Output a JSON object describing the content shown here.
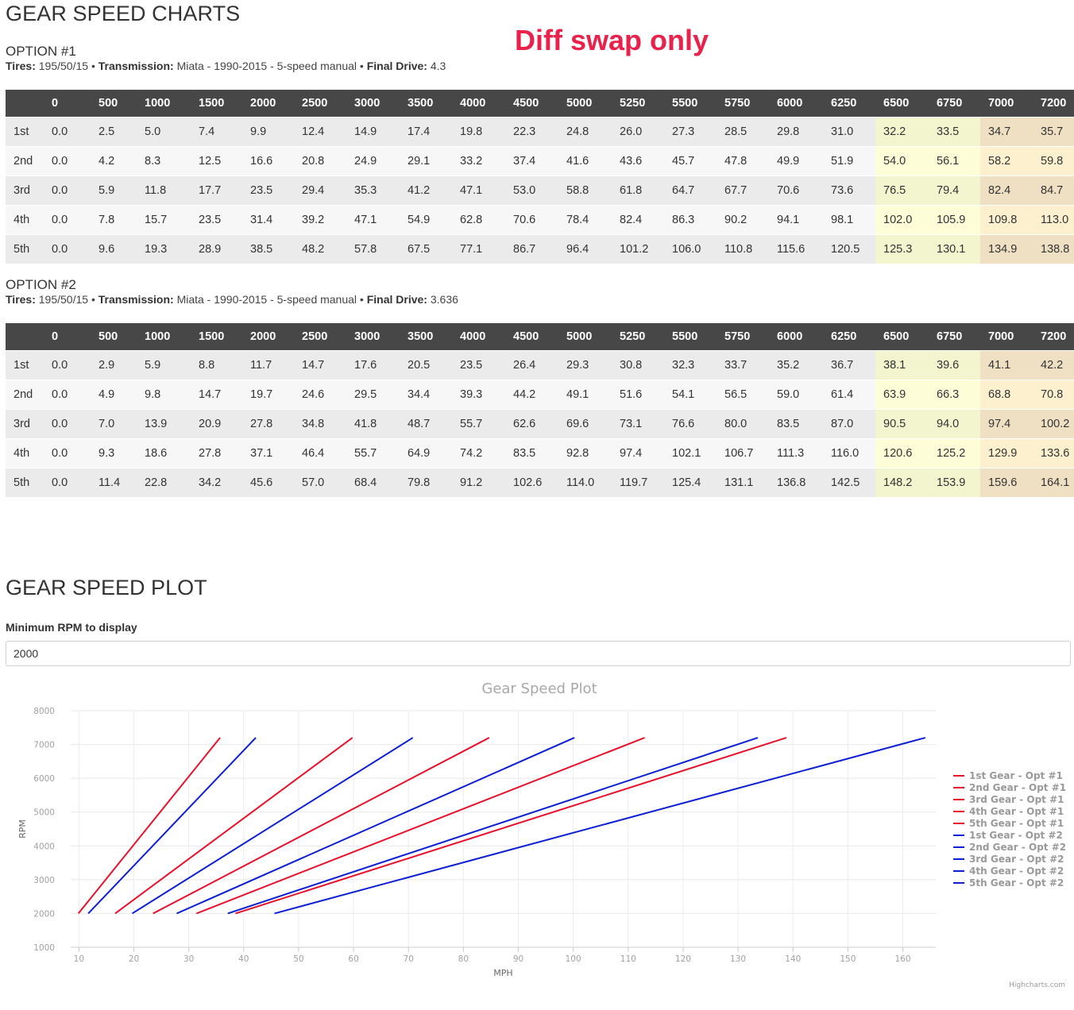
{
  "page_title": "GEAR SPEED CHARTS",
  "annotation": "Diff swap only",
  "columns": [
    "",
    "0",
    "500",
    "1000",
    "1500",
    "2000",
    "2500",
    "3000",
    "3500",
    "4000",
    "4500",
    "5000",
    "5250",
    "5500",
    "5750",
    "6000",
    "6250",
    "6500",
    "6750",
    "7000",
    "7200"
  ],
  "labels": {
    "tires": "Tires:",
    "transmission": "Transmission:",
    "final_drive": "Final Drive:",
    "sep": "•"
  },
  "options": [
    {
      "title": "OPTION #1",
      "tires": "195/50/15",
      "transmission": "Miata - 1990-2015 - 5-speed manual",
      "final_drive": "4.3",
      "rows": [
        [
          "1st",
          "0.0",
          "2.5",
          "5.0",
          "7.4",
          "9.9",
          "12.4",
          "14.9",
          "17.4",
          "19.8",
          "22.3",
          "24.8",
          "26.0",
          "27.3",
          "28.5",
          "29.8",
          "31.0",
          "32.2",
          "33.5",
          "34.7",
          "35.7"
        ],
        [
          "2nd",
          "0.0",
          "4.2",
          "8.3",
          "12.5",
          "16.6",
          "20.8",
          "24.9",
          "29.1",
          "33.2",
          "37.4",
          "41.6",
          "43.6",
          "45.7",
          "47.8",
          "49.9",
          "51.9",
          "54.0",
          "56.1",
          "58.2",
          "59.8"
        ],
        [
          "3rd",
          "0.0",
          "5.9",
          "11.8",
          "17.7",
          "23.5",
          "29.4",
          "35.3",
          "41.2",
          "47.1",
          "53.0",
          "58.8",
          "61.8",
          "64.7",
          "67.7",
          "70.6",
          "73.6",
          "76.5",
          "79.4",
          "82.4",
          "84.7"
        ],
        [
          "4th",
          "0.0",
          "7.8",
          "15.7",
          "23.5",
          "31.4",
          "39.2",
          "47.1",
          "54.9",
          "62.8",
          "70.6",
          "78.4",
          "82.4",
          "86.3",
          "90.2",
          "94.1",
          "98.1",
          "102.0",
          "105.9",
          "109.8",
          "113.0"
        ],
        [
          "5th",
          "0.0",
          "9.6",
          "19.3",
          "28.9",
          "38.5",
          "48.2",
          "57.8",
          "67.5",
          "77.1",
          "86.7",
          "96.4",
          "101.2",
          "106.0",
          "110.8",
          "115.6",
          "120.5",
          "125.3",
          "130.1",
          "134.9",
          "138.8"
        ]
      ]
    },
    {
      "title": "OPTION #2",
      "tires": "195/50/15",
      "transmission": "Miata - 1990-2015 - 5-speed manual",
      "final_drive": "3.636",
      "rows": [
        [
          "1st",
          "0.0",
          "2.9",
          "5.9",
          "8.8",
          "11.7",
          "14.7",
          "17.6",
          "20.5",
          "23.5",
          "26.4",
          "29.3",
          "30.8",
          "32.3",
          "33.7",
          "35.2",
          "36.7",
          "38.1",
          "39.6",
          "41.1",
          "42.2"
        ],
        [
          "2nd",
          "0.0",
          "4.9",
          "9.8",
          "14.7",
          "19.7",
          "24.6",
          "29.5",
          "34.4",
          "39.3",
          "44.2",
          "49.1",
          "51.6",
          "54.1",
          "56.5",
          "59.0",
          "61.4",
          "63.9",
          "66.3",
          "68.8",
          "70.8"
        ],
        [
          "3rd",
          "0.0",
          "7.0",
          "13.9",
          "20.9",
          "27.8",
          "34.8",
          "41.8",
          "48.7",
          "55.7",
          "62.6",
          "69.6",
          "73.1",
          "76.6",
          "80.0",
          "83.5",
          "87.0",
          "90.5",
          "94.0",
          "97.4",
          "100.2"
        ],
        [
          "4th",
          "0.0",
          "9.3",
          "18.6",
          "27.8",
          "37.1",
          "46.4",
          "55.7",
          "64.9",
          "74.2",
          "83.5",
          "92.8",
          "97.4",
          "102.1",
          "106.7",
          "111.3",
          "116.0",
          "120.6",
          "125.2",
          "129.9",
          "133.6"
        ],
        [
          "5th",
          "0.0",
          "11.4",
          "22.8",
          "34.2",
          "45.6",
          "57.0",
          "68.4",
          "79.8",
          "91.2",
          "102.6",
          "114.0",
          "119.7",
          "125.4",
          "131.1",
          "136.8",
          "142.5",
          "148.2",
          "153.9",
          "159.6",
          "164.1"
        ]
      ]
    }
  ],
  "plot_section": {
    "title": "GEAR SPEED PLOT",
    "min_rpm_label": "Minimum RPM to display",
    "min_rpm_value": "2000",
    "credit": "Highcharts.com"
  },
  "chart_data": {
    "type": "line",
    "title": "Gear Speed Plot",
    "xlabel": "MPH",
    "ylabel": "RPM",
    "xlim": [
      8.5,
      166
    ],
    "ylim": [
      1000,
      8000
    ],
    "x_ticks": [
      10,
      20,
      30,
      40,
      50,
      60,
      70,
      80,
      90,
      100,
      110,
      120,
      130,
      140,
      150,
      160
    ],
    "y_ticks": [
      1000,
      2000,
      3000,
      4000,
      5000,
      6000,
      7000,
      8000
    ],
    "grid": true,
    "legend": "right",
    "colors": {
      "opt1": "#e8102a",
      "opt2": "#0c1fd6"
    },
    "series": [
      {
        "name": "1st Gear - Opt #1",
        "group": "opt1",
        "x": [
          9.9,
          35.7
        ],
        "y": [
          2000,
          7200
        ]
      },
      {
        "name": "2nd Gear - Opt #1",
        "group": "opt1",
        "x": [
          16.6,
          59.8
        ],
        "y": [
          2000,
          7200
        ]
      },
      {
        "name": "3rd Gear - Opt #1",
        "group": "opt1",
        "x": [
          23.5,
          84.7
        ],
        "y": [
          2000,
          7200
        ]
      },
      {
        "name": "4th Gear - Opt #1",
        "group": "opt1",
        "x": [
          31.4,
          113.0
        ],
        "y": [
          2000,
          7200
        ]
      },
      {
        "name": "5th Gear - Opt #1",
        "group": "opt1",
        "x": [
          38.5,
          138.8
        ],
        "y": [
          2000,
          7200
        ]
      },
      {
        "name": "1st Gear - Opt #2",
        "group": "opt2",
        "x": [
          11.7,
          42.2
        ],
        "y": [
          2000,
          7200
        ]
      },
      {
        "name": "2nd Gear - Opt #2",
        "group": "opt2",
        "x": [
          19.7,
          70.8
        ],
        "y": [
          2000,
          7200
        ]
      },
      {
        "name": "3rd Gear - Opt #2",
        "group": "opt2",
        "x": [
          27.8,
          100.2
        ],
        "y": [
          2000,
          7200
        ]
      },
      {
        "name": "4th Gear - Opt #2",
        "group": "opt2",
        "x": [
          37.1,
          133.6
        ],
        "y": [
          2000,
          7200
        ]
      },
      {
        "name": "5th Gear - Opt #2",
        "group": "opt2",
        "x": [
          45.6,
          164.1
        ],
        "y": [
          2000,
          7200
        ]
      }
    ]
  }
}
